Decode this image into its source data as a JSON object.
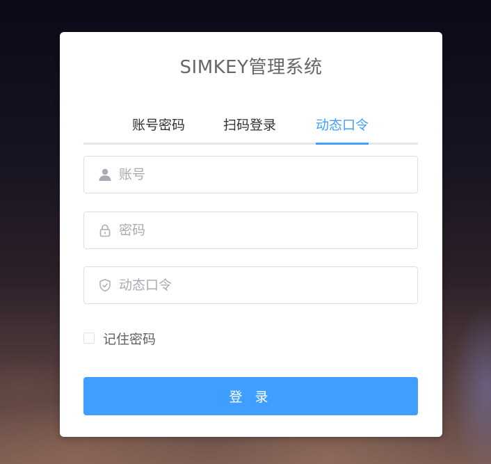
{
  "title": "SIMKEY管理系统",
  "tabs": [
    {
      "label": "账号密码",
      "active": false
    },
    {
      "label": "扫码登录",
      "active": false
    },
    {
      "label": "动态口令",
      "active": true
    }
  ],
  "fields": {
    "account": {
      "placeholder": "账号",
      "value": "",
      "icon": "user-icon"
    },
    "password": {
      "placeholder": "密码",
      "value": "",
      "icon": "lock-icon"
    },
    "otp": {
      "placeholder": "动态口令",
      "value": "",
      "icon": "shield-check-icon"
    }
  },
  "remember": {
    "label": "记住密码",
    "checked": false
  },
  "login_button": {
    "label": "登 录"
  },
  "colors": {
    "accent": "#409eff",
    "border": "#dcdfe6",
    "title": "#666666",
    "placeholder": "#a8abb2"
  }
}
